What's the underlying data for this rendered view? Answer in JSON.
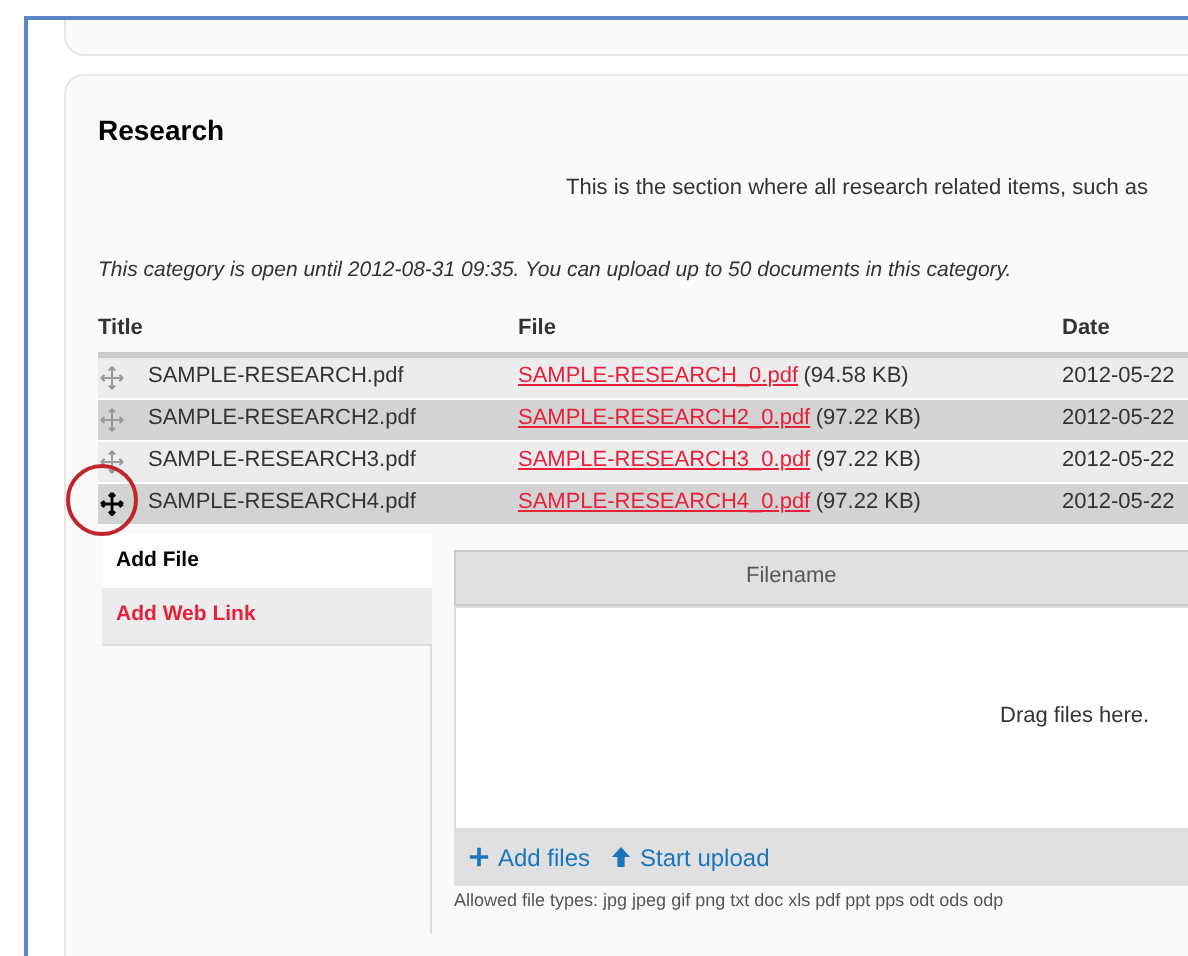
{
  "section": {
    "title": "Research",
    "description": "This is the section where all research related items, such as",
    "notice": "This category is open until 2012-08-31 09:35. You can upload up to 50 documents in this category."
  },
  "table": {
    "columns": [
      "Title",
      "File",
      "Date"
    ],
    "rows": [
      {
        "title": "SAMPLE-RESEARCH.pdf",
        "file": "SAMPLE-RESEARCH_0.pdf",
        "size": "(94.58 KB)",
        "date": "2012-05-22",
        "highlighted": false
      },
      {
        "title": "SAMPLE-RESEARCH2.pdf",
        "file": "SAMPLE-RESEARCH2_0.pdf",
        "size": "(97.22 KB)",
        "date": "2012-05-22",
        "highlighted": false
      },
      {
        "title": "SAMPLE-RESEARCH3.pdf",
        "file": "SAMPLE-RESEARCH3_0.pdf",
        "size": "(97.22 KB)",
        "date": "2012-05-22",
        "highlighted": false
      },
      {
        "title": "SAMPLE-RESEARCH4.pdf",
        "file": "SAMPLE-RESEARCH4_0.pdf",
        "size": "(97.22 KB)",
        "date": "2012-05-22",
        "highlighted": true
      }
    ]
  },
  "tabs": [
    {
      "label": "Add File",
      "selected": true
    },
    {
      "label": "Add Web Link",
      "selected": false
    }
  ],
  "uploader": {
    "column": "Filename",
    "drop_hint": "Drag files here.",
    "buttons": [
      {
        "label": "Add files",
        "kind": "add"
      },
      {
        "label": "Start upload",
        "kind": "upload"
      }
    ],
    "allowed": "Allowed file types: jpg jpeg gif png txt doc xls pdf ppt pps odt ods odp"
  }
}
